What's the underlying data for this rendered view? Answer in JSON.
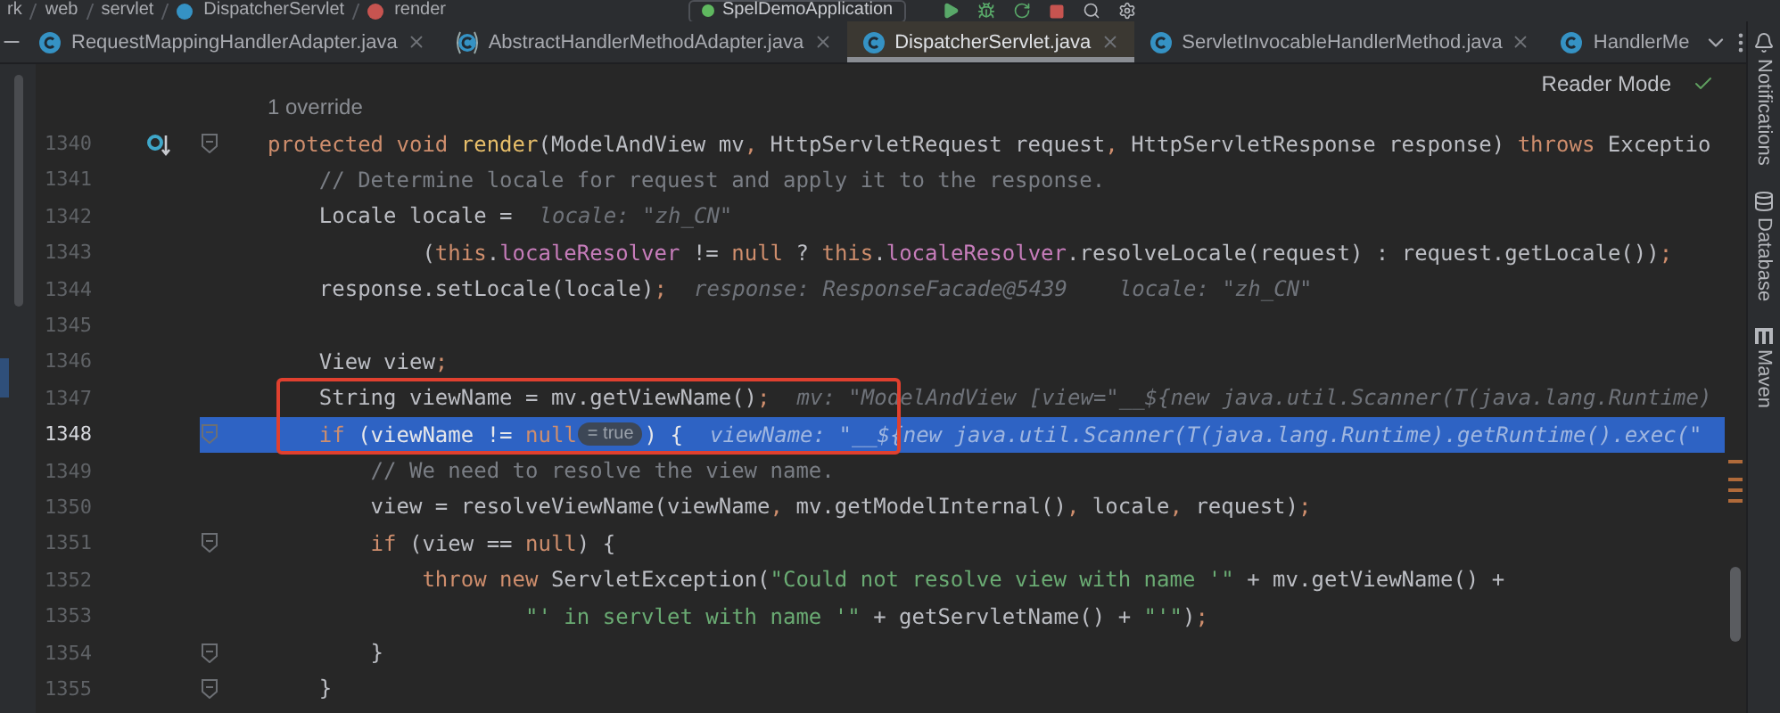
{
  "breadcrumbs": [
    {
      "label": "rk",
      "kind": "folder"
    },
    {
      "label": "web",
      "kind": "folder"
    },
    {
      "label": "servlet",
      "kind": "folder"
    },
    {
      "label": "DispatcherServlet",
      "kind": "class"
    },
    {
      "label": "render",
      "kind": "method"
    }
  ],
  "run_config": {
    "label": "SpelDemoApplication"
  },
  "tabs": [
    {
      "label": "RequestMappingHandlerAdapter.java",
      "kind": "class",
      "selected": false,
      "closable": true
    },
    {
      "label": "AbstractHandlerMethodAdapter.java",
      "kind": "abstract",
      "selected": false,
      "closable": true
    },
    {
      "label": "DispatcherServlet.java",
      "kind": "class",
      "selected": true,
      "closable": true
    },
    {
      "label": "ServletInvocableHandlerMethod.java",
      "kind": "class",
      "selected": false,
      "closable": true
    },
    {
      "label": "HandlerMe",
      "kind": "class",
      "selected": false,
      "closable": false
    }
  ],
  "editor": {
    "reader_mode": "Reader Mode",
    "code_vision": "1 override",
    "lines": [
      {
        "number": "1340",
        "gutter": {
          "kind": "override"
        },
        "fold": true,
        "current": false,
        "framed": false,
        "tokens": [
          {
            "kind": "keyword",
            "text": "protected void "
          },
          {
            "kind": "declaration",
            "text": "render"
          },
          {
            "kind": "plain",
            "text": "(ModelAndView mv"
          },
          {
            "kind": "punct",
            "text": ", "
          },
          {
            "kind": "plain",
            "text": "HttpServletRequest request"
          },
          {
            "kind": "punct",
            "text": ", "
          },
          {
            "kind": "plain",
            "text": "HttpServletResponse response) "
          },
          {
            "kind": "keyword",
            "text": "throws "
          },
          {
            "kind": "plain",
            "text": "Exceptio"
          }
        ]
      },
      {
        "number": "1341",
        "fold": false,
        "current": false,
        "framed": false,
        "tokens": [
          {
            "kind": "comment",
            "text": "    // Determine locale for request and apply it to the response."
          }
        ]
      },
      {
        "number": "1342",
        "fold": false,
        "current": false,
        "framed": false,
        "tokens": [
          {
            "kind": "plain",
            "text": "    Locale locale ="
          },
          {
            "kind": "hint",
            "text": "locale: \"zh_CN\""
          }
        ]
      },
      {
        "number": "1343",
        "fold": false,
        "current": false,
        "framed": false,
        "tokens": [
          {
            "kind": "plain",
            "text": "            ("
          },
          {
            "kind": "keyword",
            "text": "this"
          },
          {
            "kind": "plain",
            "text": "."
          },
          {
            "kind": "field",
            "text": "localeResolver"
          },
          {
            "kind": "plain",
            "text": " != "
          },
          {
            "kind": "keyword",
            "text": "null"
          },
          {
            "kind": "plain",
            "text": " ? "
          },
          {
            "kind": "keyword",
            "text": "this"
          },
          {
            "kind": "plain",
            "text": "."
          },
          {
            "kind": "field",
            "text": "localeResolver"
          },
          {
            "kind": "plain",
            "text": ".resolveLocale(request) : request.getLocale())"
          },
          {
            "kind": "punct",
            "text": ";"
          }
        ]
      },
      {
        "number": "1344",
        "fold": false,
        "current": false,
        "framed": false,
        "tokens": [
          {
            "kind": "plain",
            "text": "    response.setLocale(locale)"
          },
          {
            "kind": "punct",
            "text": ";"
          },
          {
            "kind": "hint",
            "text": "response: ResponseFacade@5439    locale: \"zh_CN\""
          }
        ]
      },
      {
        "number": "1345",
        "fold": false,
        "current": false,
        "framed": false
      },
      {
        "number": "1346",
        "fold": false,
        "current": false,
        "framed": false,
        "tokens": [
          {
            "kind": "plain",
            "text": "    View view"
          },
          {
            "kind": "punct",
            "text": ";"
          }
        ]
      },
      {
        "number": "1347",
        "fold": false,
        "current": false,
        "framed": true,
        "tokens": [
          {
            "kind": "plain",
            "text": "    String viewName = mv.getViewName()"
          },
          {
            "kind": "punct",
            "text": ";"
          },
          {
            "kind": "hint",
            "text": "mv: \"ModelAndView [view=\"__${new java.util.Scanner(T(java.lang.Runtime)"
          }
        ]
      },
      {
        "number": "1348",
        "fold": true,
        "current": true,
        "framed": true,
        "tokens": [
          {
            "kind": "keyword",
            "text": "    if"
          },
          {
            "kind": "plain",
            "text": " (viewName != "
          },
          {
            "kind": "keyword",
            "text": "null"
          },
          {
            "kind": "badge",
            "text": "= true"
          },
          {
            "kind": "plain",
            "text": ") {"
          },
          {
            "kind": "hint",
            "text": "viewName: \"__${new java.util.Scanner(T(java.lang.Runtime).getRuntime().exec(\""
          }
        ]
      },
      {
        "number": "1349",
        "fold": false,
        "current": false,
        "framed": false,
        "tokens": [
          {
            "kind": "comment",
            "text": "        // We need to resolve the view name."
          }
        ]
      },
      {
        "number": "1350",
        "fold": false,
        "current": false,
        "framed": false,
        "tokens": [
          {
            "kind": "plain",
            "text": "        view = resolveViewName(viewName"
          },
          {
            "kind": "punct",
            "text": ", "
          },
          {
            "kind": "plain",
            "text": "mv.getModelInternal()"
          },
          {
            "kind": "punct",
            "text": ", "
          },
          {
            "kind": "plain",
            "text": "locale"
          },
          {
            "kind": "punct",
            "text": ", "
          },
          {
            "kind": "plain",
            "text": "request)"
          },
          {
            "kind": "punct",
            "text": ";"
          }
        ]
      },
      {
        "number": "1351",
        "fold": true,
        "current": false,
        "framed": false,
        "tokens": [
          {
            "kind": "keyword",
            "text": "        if"
          },
          {
            "kind": "plain",
            "text": " (view == "
          },
          {
            "kind": "keyword",
            "text": "null"
          },
          {
            "kind": "plain",
            "text": ") {"
          }
        ]
      },
      {
        "number": "1352",
        "fold": false,
        "current": false,
        "framed": false,
        "tokens": [
          {
            "kind": "keyword",
            "text": "            throw new "
          },
          {
            "kind": "plain",
            "text": "ServletException("
          },
          {
            "kind": "string",
            "text": "\"Could not resolve view with name '\""
          },
          {
            "kind": "plain",
            "text": " + mv.getViewName() +"
          }
        ]
      },
      {
        "number": "1353",
        "fold": false,
        "current": false,
        "framed": false,
        "tokens": [
          {
            "kind": "string",
            "text": "                    \"' in servlet with name '\""
          },
          {
            "kind": "plain",
            "text": " + getServletName() + "
          },
          {
            "kind": "string",
            "text": "\"'\""
          },
          {
            "kind": "plain",
            "text": ")"
          },
          {
            "kind": "punct",
            "text": ";"
          }
        ]
      },
      {
        "number": "1354",
        "fold": true,
        "current": false,
        "framed": false,
        "tokens": [
          {
            "kind": "plain",
            "text": "        }"
          }
        ]
      },
      {
        "number": "1355",
        "fold": true,
        "current": false,
        "framed": false,
        "tokens": [
          {
            "kind": "plain",
            "text": "    }"
          }
        ]
      }
    ]
  },
  "side_tools": [
    {
      "label": "Notifications",
      "kind": "bell"
    },
    {
      "label": "Database",
      "kind": "database"
    },
    {
      "label": "Maven",
      "kind": "maven"
    }
  ]
}
